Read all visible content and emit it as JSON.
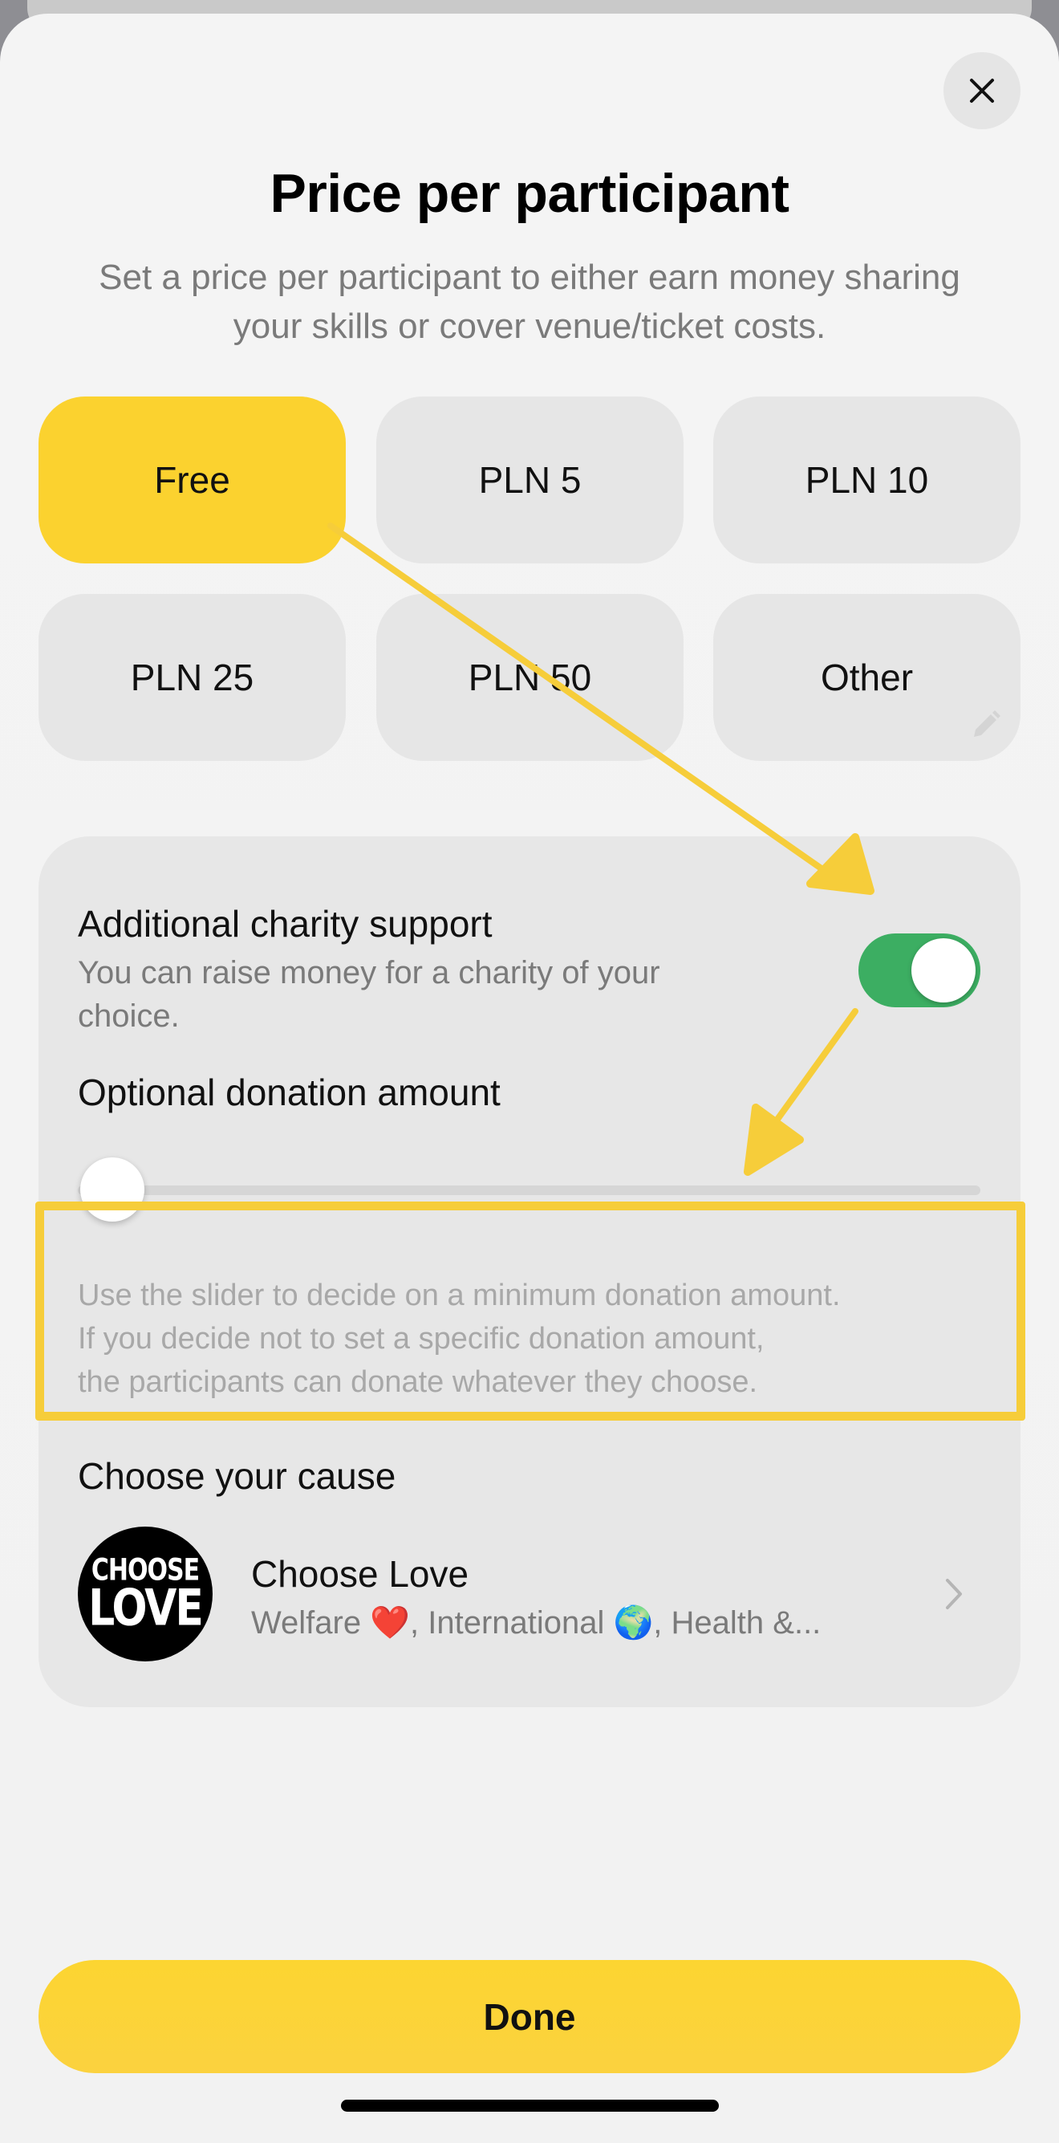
{
  "modal": {
    "close_icon": "close-icon",
    "title": "Price per participant",
    "subtitle": "Set a price per participant to either earn money sharing your skills or cover venue/ticket costs."
  },
  "price_options": [
    {
      "label": "Free",
      "selected": true
    },
    {
      "label": "PLN 5",
      "selected": false
    },
    {
      "label": "PLN 10",
      "selected": false
    },
    {
      "label": "PLN 25",
      "selected": false
    },
    {
      "label": "PLN 50",
      "selected": false
    },
    {
      "label": "Other",
      "selected": false,
      "icon": "pencil-icon"
    }
  ],
  "charity": {
    "title": "Additional charity support",
    "description": "You can raise money for a charity of your choice.",
    "toggle_on": true,
    "donation_title": "Optional donation amount",
    "slider_value": 0,
    "hint_lines": [
      "Use the slider to decide on a minimum donation amount.",
      "If you decide not to set a specific donation amount,",
      "the participants can donate whatever they choose."
    ],
    "cause_title": "Choose your cause",
    "cause": {
      "logo_line1": "CHOOSE",
      "logo_line2": "LOVE",
      "name": "Choose Love",
      "tags": "Welfare ❤️, International 🌍, Health &..."
    }
  },
  "done_label": "Done",
  "colors": {
    "accent_yellow": "#fbd22f",
    "toggle_green": "#3cae62",
    "annotation_yellow": "#f6cd3a"
  }
}
